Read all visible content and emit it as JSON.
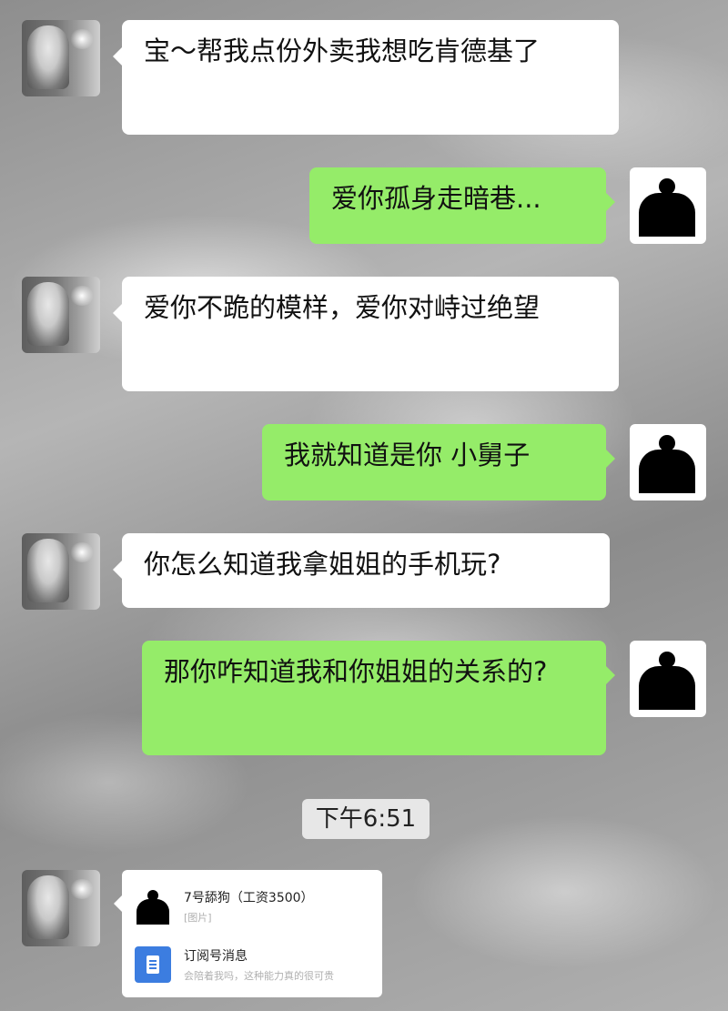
{
  "messages": [
    {
      "side": "left",
      "text": "宝～帮我点份外卖我想吃肯德基了"
    },
    {
      "side": "right",
      "text": "爱你孤身走暗巷..."
    },
    {
      "side": "left",
      "text": "爱你不跪的模样，爱你对峙过绝望"
    },
    {
      "side": "right",
      "text": "我就知道是你 小舅子"
    },
    {
      "side": "left",
      "text": "你怎么知道我拿姐姐的手机玩?"
    },
    {
      "side": "right",
      "text": "那你咋知道我和你姐姐的关系的?"
    }
  ],
  "timestamp": "下午6:51",
  "card": {
    "item1_title": "7号舔狗（工资3500）",
    "item1_sub": "[图片]",
    "item2_title": "订阅号消息",
    "item2_sub": "会陪着我吗，这种能力真的很可贵"
  },
  "icons": {
    "avatar_left": "girl-photo-avatar",
    "avatar_right": "silhouette-avatar"
  },
  "colors": {
    "sent_bubble": "#95ec69",
    "received_bubble": "#ffffff"
  }
}
